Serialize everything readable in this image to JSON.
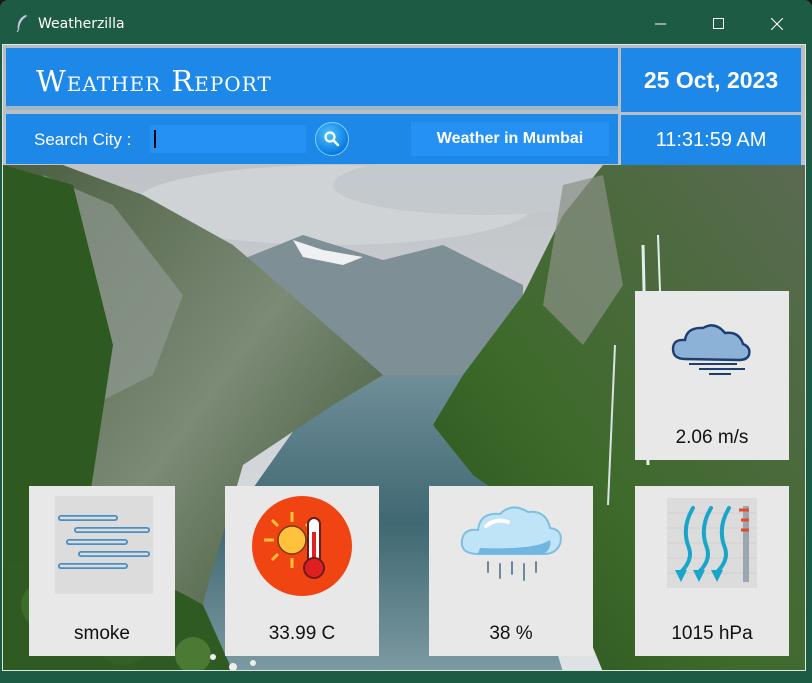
{
  "window": {
    "title": "Weatherzilla"
  },
  "header": {
    "title": "Weather Report",
    "date": "25 Oct, 2023",
    "time": "11:31:59 AM"
  },
  "search": {
    "label": "Search City :",
    "value": "",
    "button_icon": "search-icon",
    "weather_in_label": "Weather in Mumbai"
  },
  "cards": {
    "wind": {
      "icon": "wind-cloud-icon",
      "value": "2.06 m/s"
    },
    "description": {
      "icon": "smoke-icon",
      "value": "smoke"
    },
    "temperature": {
      "icon": "thermometer-sun-icon",
      "value": "33.99 C"
    },
    "humidity": {
      "icon": "rain-cloud-icon",
      "value": "38 %"
    },
    "pressure": {
      "icon": "pressure-icon",
      "value": "1015 hPa"
    }
  },
  "colors": {
    "titlebar": "#1e5b44",
    "header_blue": "#1e88e8",
    "card_bg": "#e8e8e8"
  }
}
